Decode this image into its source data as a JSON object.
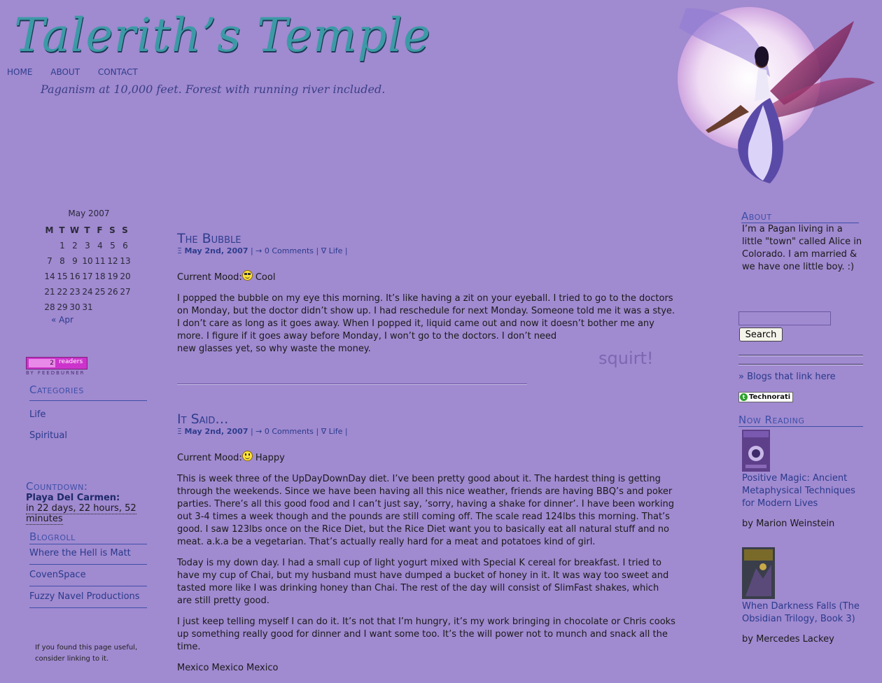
{
  "header": {
    "site_title": "Talerith’s Temple",
    "tagline": "Paganism at 10,000 feet. Forest with running river included.",
    "nav": [
      "HOME",
      "ABOUT",
      "CONTACT"
    ]
  },
  "calendar": {
    "caption": "May 2007",
    "weekdays": [
      "M",
      "T",
      "W",
      "T",
      "F",
      "S",
      "S"
    ],
    "weeks": [
      [
        "",
        "1",
        "2",
        "3",
        "4",
        "5",
        "6"
      ],
      [
        "7",
        "8",
        "9",
        "10",
        "11",
        "12",
        "13"
      ],
      [
        "14",
        "15",
        "16",
        "17",
        "18",
        "19",
        "20"
      ],
      [
        "21",
        "22",
        "23",
        "24",
        "25",
        "26",
        "27"
      ],
      [
        "28",
        "29",
        "30",
        "31",
        "",
        "",
        ""
      ]
    ],
    "prev_label": "« Apr"
  },
  "feed_badge": {
    "count": "2",
    "label": "readers",
    "by": "BY FEEDBURNER"
  },
  "categories": {
    "heading": "Categories",
    "items": [
      "Life",
      "Spiritual"
    ]
  },
  "countdown": {
    "heading": "Countdown:",
    "event": "Playa Del Carmen:",
    "time_line1": "in 22 days, 22 hours, 52",
    "time_line2": "minutes"
  },
  "blogroll": {
    "heading": "Blogroll",
    "items": [
      "Where the Hell is Matt",
      "CovenSpace",
      "Fuzzy Navel Productions"
    ]
  },
  "useful_note": {
    "line1": "If you found this page useful,",
    "line2": "consider linking to it."
  },
  "posts": [
    {
      "title": "The Bubble",
      "meta_prefix": "Ξ ",
      "date": "May 2nd, 2007",
      "sep1": " | ",
      "comments": "→ 0 Comments",
      "sep2": " | ",
      "category": "∇ Life",
      "sep3": " |",
      "mood_label": "Current Mood:",
      "mood": "Cool",
      "paragraphs": [
        "I popped the bubble on my eye this morning. It’s like having a zit on your eyeball. I tried to go to the doctors on Monday, but the doctor didn’t show up. I had reschedule for next Monday. Someone told me it was a stye. I don’t care as long as it goes away. When I popped it, liquid came out and now it doesn’t bother me any more. I figure if it goes away before Monday, I won’t go to the doctors. I don’t need",
        "new glasses yet, so why waste the money."
      ],
      "aside": "squirt!"
    },
    {
      "title": "It Said…",
      "meta_prefix": "Ξ ",
      "date": "May 2nd, 2007",
      "sep1": " | ",
      "comments": "→ 0 Comments",
      "sep2": " | ",
      "category": "∇ Life",
      "sep3": " |",
      "mood_label": "Current Mood:",
      "mood": "Happy",
      "paragraphs": [
        "This is week three of the UpDayDownDay diet. I’ve been pretty good about it. The hardest thing is getting through the weekends. Since we have been having all this nice weather, friends are having BBQ’s and poker parties. There’s all this good food and I can’t just say, ’sorry, having a shake for dinner’. I have been working out 3-4 times a week though and the pounds are still coming off. The scale read 124lbs this morning. That’s good. I saw 123lbs once on the Rice Diet, but the Rice Diet want you to basically eat all natural stuff and no meat. a.k.a be a vegetarian. That’s actually really hard for a meat and potatoes kind of girl.",
        "Today is my down day. I had a small cup of light yogurt mixed with Special K cereal for breakfast. I tried to have my cup of Chai, but my husband must have dumped a bucket of honey in it. It was way too sweet and tasted more like I was drinking honey than Chai. The rest of the day will consist of SlimFast shakes, which are still pretty good.",
        "I just keep telling myself I can do it. It’s not that I’m hungry, it’s my work bringing in chocolate or Chris cooks up something really good for dinner and I want some too. It’s the will power not to munch and snack all the time.",
        "Mexico Mexico Mexico"
      ]
    }
  ],
  "about": {
    "heading": "About",
    "text": "I’m a Pagan living in a little \"town\" called Alice in Colorado. I am married & we have one little boy. :)"
  },
  "search": {
    "placeholder": "",
    "button": "Search"
  },
  "links": {
    "blogs_link": "» Blogs that link here",
    "technorati": "Technorati"
  },
  "now_reading": {
    "heading": "Now Reading",
    "books": [
      {
        "title": "Positive Magic: Ancient Metaphysical Techniques for Modern Lives",
        "author": "by Marion Weinstein"
      },
      {
        "title": "When Darkness Falls (The Obsidian Trilogy, Book 3)",
        "author": "by Mercedes Lackey"
      }
    ]
  },
  "colors": {
    "background": "#a08ad0",
    "link": "#2a3a8c",
    "heading": "#3e4fa8",
    "title_teal": "#3c9aa6"
  }
}
